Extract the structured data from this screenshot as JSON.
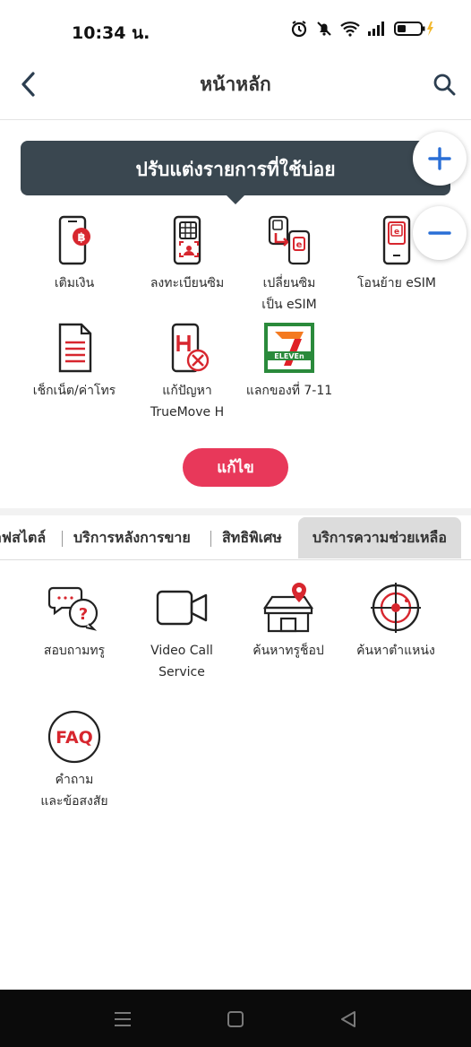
{
  "status_bar": {
    "time": "10:34 น."
  },
  "header": {
    "title": "หน้าหลัก"
  },
  "tooltip": {
    "text": "ปรับแต่งรายการที่ใช้บ่อย"
  },
  "favorites": {
    "items": [
      {
        "label": "เติมเงิน",
        "icon": "topup-phone-icon"
      },
      {
        "label": "ลงทะเบียนซิม",
        "icon": "sim-register-icon"
      },
      {
        "label": "เปลี่ยนซิม\nเป็น eSIM",
        "icon": "sim-to-esim-icon"
      },
      {
        "label": "โอนย้าย eSIM",
        "icon": "esim-transfer-icon"
      },
      {
        "label": "เช็กเน็ต/ค่าโทร",
        "icon": "document-icon"
      },
      {
        "label": "แก้ปัญหา\nTrueMove H",
        "icon": "phone-repair-icon"
      },
      {
        "label": "แลกของที่ 7-11",
        "icon": "seven-eleven-logo"
      }
    ],
    "edit_label": "แก้ไข"
  },
  "tabs": [
    {
      "label": "ลฟสไตล์",
      "active": false
    },
    {
      "label": "บริการหลังการขาย",
      "active": false
    },
    {
      "label": "สิทธิพิเศษ",
      "active": false
    },
    {
      "label": "บริการความช่วยเหลือ",
      "active": true
    }
  ],
  "support": {
    "items": [
      {
        "label": "สอบถามทรู",
        "icon": "chat-question-icon"
      },
      {
        "label": "Video Call\nService",
        "icon": "video-camera-icon"
      },
      {
        "label": "ค้นหาทรูช็อป",
        "icon": "shop-location-icon"
      },
      {
        "label": "ค้นหาตำแหน่ง",
        "icon": "target-locate-icon"
      },
      {
        "label": "คำถาม\nและข้อสงสัย",
        "icon": "faq-icon"
      }
    ]
  },
  "colors": {
    "accent_red": "#e8385a",
    "brand_red": "#d7262e",
    "tooltip_bg": "#3a4750",
    "fab_blue": "#2a6fd6"
  }
}
